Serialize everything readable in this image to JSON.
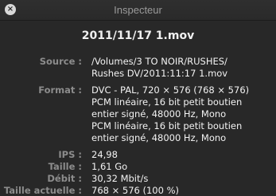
{
  "window": {
    "title": "Inspecteur",
    "close_icon": "close-icon"
  },
  "file": {
    "name": "2011/11/17 1.mov"
  },
  "info": {
    "source": {
      "label": "Source :",
      "lines": [
        "/Volumes/3 TO NOIR/RUSHES/",
        "Rushes DV/2011:11:17 1.mov"
      ]
    },
    "format": {
      "label": "Format :",
      "lines": [
        "DVC - PAL, 720 × 576 (768 × 576)",
        "PCM linéaire, 16 bit petit boutien",
        "entier signé, 48000 Hz, Mono",
        "PCM linéaire, 16 bit petit boutien",
        "entier signé, 48000 Hz, Mono"
      ]
    },
    "ips": {
      "label": "IPS :",
      "value": "24,98"
    },
    "taille": {
      "label": "Taille :",
      "value": "1,61 Go"
    },
    "debit": {
      "label": "Débit :",
      "value": "30,32 Mbit/s"
    },
    "taille_actuelle": {
      "label": "Taille actuelle :",
      "value": "768 × 576 (100 %)"
    }
  }
}
